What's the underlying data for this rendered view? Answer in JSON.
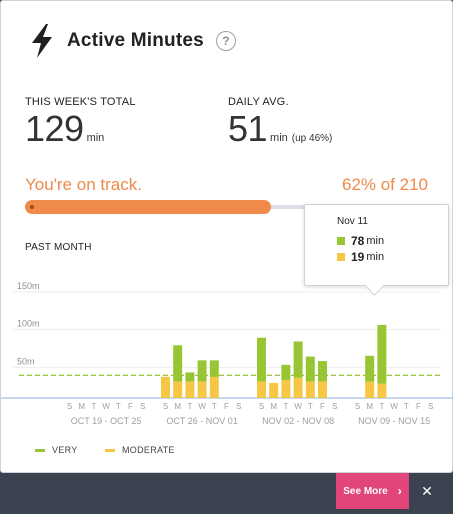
{
  "header": {
    "title": "Active Minutes",
    "help_glyph": "?",
    "icon": "lightning-bolt-icon"
  },
  "stats": {
    "week_total": {
      "label": "THIS WEEK'S TOTAL",
      "value": "129",
      "unit": "min"
    },
    "daily_avg": {
      "label": "DAILY AVG.",
      "value": "51",
      "unit": "min",
      "extra": "(up 46%)"
    }
  },
  "progress": {
    "message": "You're on track.",
    "summary": "62% of 210",
    "fraction": 0.62
  },
  "chart_section": {
    "label": "PAST MONTH"
  },
  "tooltip": {
    "date": "Nov 11",
    "very_value": "78",
    "moderate_value": "19",
    "unit": "min"
  },
  "legend": {
    "very_label": "VERY",
    "moderate_label": "MODERATE"
  },
  "colors": {
    "very": "#97c533",
    "moderate": "#f6c744",
    "accent": "#ef8a4a",
    "goal_line": "#97c533",
    "see_more": "#e2457a"
  },
  "footer": {
    "see_more_label": "See More",
    "close_glyph": "✕"
  },
  "chart_data": {
    "type": "bar",
    "stacked": true,
    "y_ticks": [
      "150m",
      "100m",
      "50m"
    ],
    "ylim": [
      0,
      150
    ],
    "goal_line": 30,
    "day_letters": [
      "S",
      "M",
      "T",
      "W",
      "T",
      "F",
      "S"
    ],
    "weeks": [
      {
        "label": "OCT 19 - OCT 25",
        "very": [
          0,
          0,
          0,
          0,
          0,
          0,
          0
        ],
        "moderate": [
          0,
          0,
          0,
          0,
          0,
          0,
          0
        ]
      },
      {
        "label": "OCT 26 - NOV 01",
        "very": [
          0,
          48,
          12,
          28,
          22,
          0,
          0
        ],
        "moderate": [
          28,
          22,
          22,
          22,
          28,
          0,
          0
        ]
      },
      {
        "label": "NOV 02 - NOV 08",
        "very": [
          58,
          0,
          20,
          48,
          33,
          27,
          0
        ],
        "moderate": [
          22,
          20,
          24,
          27,
          22,
          22,
          0
        ]
      },
      {
        "label": "NOV 09 - NOV 15",
        "very": [
          0,
          34,
          78,
          0,
          0,
          0,
          0
        ],
        "moderate": [
          0,
          22,
          19,
          0,
          0,
          0,
          0
        ]
      }
    ]
  }
}
